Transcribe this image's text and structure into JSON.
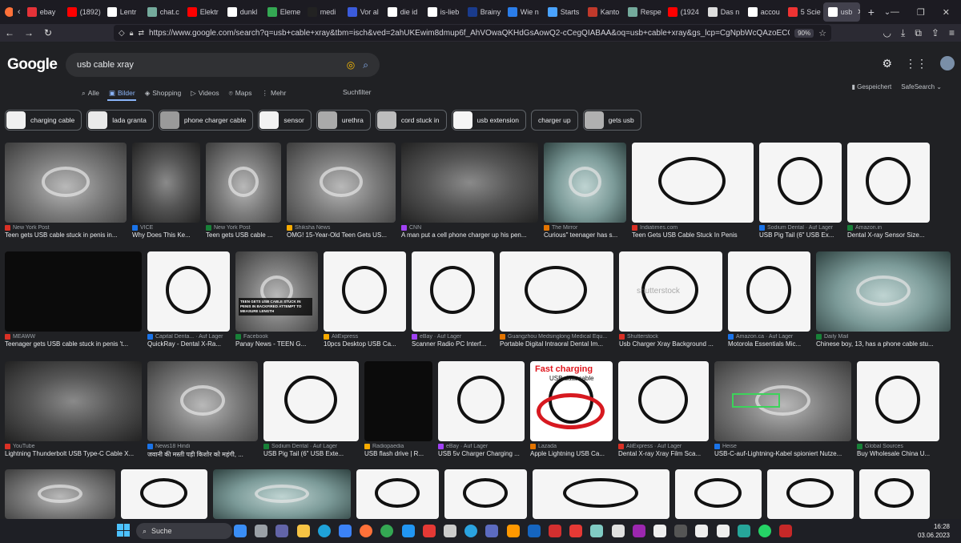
{
  "browser": {
    "tabs": [
      {
        "label": "ebay",
        "icon": "ebay-icon",
        "color": "#e53238"
      },
      {
        "label": "(1892)",
        "icon": "youtube-icon",
        "color": "#ff0000"
      },
      {
        "label": "Lentr",
        "icon": "wikipedia-icon",
        "color": "#ffffff"
      },
      {
        "label": "chat.c",
        "icon": "chatgpt-icon",
        "color": "#74aa9c"
      },
      {
        "label": "Elektr",
        "icon": "youtube-icon",
        "color": "#ff0000"
      },
      {
        "label": "dunkl",
        "icon": "google-icon",
        "color": "#ffffff"
      },
      {
        "label": "Eleme",
        "icon": "sheet-icon",
        "color": "#34a853"
      },
      {
        "label": "medi",
        "icon": "medium-icon",
        "color": "#222222"
      },
      {
        "label": "Vor al",
        "icon": "site-icon",
        "color": "#3b5bdb"
      },
      {
        "label": "die id",
        "icon": "google-icon",
        "color": "#ffffff"
      },
      {
        "label": "is-lieb",
        "icon": "google-icon",
        "color": "#ffffff"
      },
      {
        "label": "Brainy",
        "icon": "site-icon",
        "color": "#1a3b8c"
      },
      {
        "label": "Wie n",
        "icon": "site-icon",
        "color": "#2b7de9"
      },
      {
        "label": "Starts",
        "icon": "site-icon",
        "color": "#4aa3ff"
      },
      {
        "label": "Kanto",
        "icon": "site-icon",
        "color": "#c0392b"
      },
      {
        "label": "Respe",
        "icon": "chatgpt-icon",
        "color": "#74aa9c"
      },
      {
        "label": "(1924",
        "icon": "youtube-icon",
        "color": "#ff0000"
      },
      {
        "label": "Das n",
        "icon": "star-icon",
        "color": "#dddddd"
      },
      {
        "label": "accou",
        "icon": "google-icon",
        "color": "#ffffff"
      },
      {
        "label": "5 Scie",
        "icon": "site-icon",
        "color": "#e33"
      },
      {
        "label": "usb",
        "icon": "google-icon",
        "color": "#ffffff",
        "active": true
      }
    ],
    "new_tab": "+",
    "url": "https://www.google.com/search?q=usb+cable+xray&tbm=isch&ved=2ahUKEwim8dmup6f_AhVOwaQKHdGsAowQ2-cCegQIABAA&oq=usb+cable+xray&gs_lcp=CgNpbWcQAzoECCMQJzoGCAAQBxAeOgc",
    "zoom": "90%"
  },
  "google": {
    "logo": "Google",
    "query": "usb cable xray",
    "search_tabs": [
      {
        "label": "Alle",
        "icon": "search-icon"
      },
      {
        "label": "Bilder",
        "icon": "image-icon",
        "active": true
      },
      {
        "label": "Shopping",
        "icon": "tag-icon"
      },
      {
        "label": "Videos",
        "icon": "play-icon"
      },
      {
        "label": "Maps",
        "icon": "pin-icon"
      },
      {
        "label": "Mehr",
        "icon": "more-icon"
      }
    ],
    "filter": "Suchfilter",
    "saved": "Gespeichert",
    "safesearch": "SafeSearch",
    "chips": [
      {
        "label": "charging cable",
        "thumb": true
      },
      {
        "label": "lada granta",
        "thumb": true
      },
      {
        "label": "phone charger cable",
        "thumb": true
      },
      {
        "label": "sensor",
        "thumb": true
      },
      {
        "label": "urethra",
        "thumb": true
      },
      {
        "label": "cord stuck in",
        "thumb": true
      },
      {
        "label": "usb extension",
        "thumb": true
      },
      {
        "label": "charger up",
        "thumb": false
      },
      {
        "label": "gets usb",
        "thumb": true
      }
    ]
  },
  "results": {
    "row1": [
      {
        "source": "New York Post",
        "title": "Teen gets USB cable stuck in penis in...",
        "style": "xray",
        "w": 152
      },
      {
        "source": "VICE",
        "title": "Why Does This Ke...",
        "style": "xray-dark",
        "w": 85
      },
      {
        "source": "New York Post",
        "title": "Teen gets USB cable ...",
        "style": "xray",
        "w": 94
      },
      {
        "source": "Shiksha News",
        "title": "OMG! 15-Year-Old Teen Gets US...",
        "style": "xray",
        "w": 136
      },
      {
        "source": "CNN",
        "title": "A man put a cell phone charger up his pen...",
        "style": "xray-dark",
        "w": 171
      },
      {
        "source": "The Mirror",
        "title": "Curious\" teenager has s...",
        "style": "teal",
        "w": 103
      },
      {
        "source": "Indiatimes.com",
        "title": "Teen Gets USB Cable Stuck In Penis",
        "style": "white",
        "w": 152
      },
      {
        "source": "Sodium Dental · Auf Lager",
        "title": "USB Pig Tail (6\" USB Ex...",
        "style": "white",
        "w": 103
      },
      {
        "source": "Amazon.in",
        "title": "Dental X-ray Sensor Size...",
        "style": "white",
        "w": 103
      }
    ],
    "row2": [
      {
        "source": "MEAWW",
        "title": "Teenager gets USB cable stuck in penis 't...",
        "style": "black",
        "w": 171
      },
      {
        "source": "Capital Denta... · Auf Lager",
        "title": "QuickRay - Dental X-Ra...",
        "style": "white",
        "w": 103
      },
      {
        "source": "Facebook",
        "title": "Panay News - TEEN G...",
        "style": "xray",
        "w": 103
      },
      {
        "source": "AliExpress",
        "title": "10pcs Desktop USB Ca...",
        "style": "white",
        "w": 103
      },
      {
        "source": "eBay · Auf Lager",
        "title": "Scanner Radio PC Interf...",
        "style": "white",
        "w": 103
      },
      {
        "source": "Guangzhou Medsinglong Medical Equ...",
        "title": "Portable Digital Intraoral Dental Im...",
        "style": "white",
        "w": 142
      },
      {
        "source": "Shutterstock",
        "title": "Usb Charger Xray Background ...",
        "style": "white",
        "w": 129
      },
      {
        "source": "Amazon.ca · Auf Lager",
        "title": "Motorola Essentials Mic...",
        "style": "white",
        "w": 103
      },
      {
        "source": "Daily Mail",
        "title": "Chinese boy, 13, has a phone cable stu...",
        "style": "teal",
        "w": 168
      }
    ],
    "row3": [
      {
        "source": "YouTube",
        "title": "Lightning Thunderbolt USB Type-C Cable X...",
        "style": "xray-dark",
        "w": 171
      },
      {
        "source": "News18 Hindi",
        "title": "जवानी की मस्ती पड़ी किशोर को महंगी, ...",
        "style": "xray",
        "w": 138
      },
      {
        "source": "Sodium Dental · Auf Lager",
        "title": "USB Pig Tail (6\" USB Exte...",
        "style": "white",
        "w": 119
      },
      {
        "source": "Radiopaedia",
        "title": "USB flash drive | R...",
        "style": "black",
        "w": 85
      },
      {
        "source": "eBay · Auf Lager",
        "title": "USB 5v Charger Charging ...",
        "style": "white",
        "w": 108
      },
      {
        "source": "Lazada",
        "title": "Apple Lightning USB Ca...",
        "style": "white",
        "w": 103
      },
      {
        "source": "AliExpress · Auf Lager",
        "title": "Dental X-ray Xray Film Sca...",
        "style": "white",
        "w": 113
      },
      {
        "source": "Heise",
        "title": "USB-C-auf-Lightning-Kabel spioniert Nutze...",
        "style": "xray",
        "w": 171
      },
      {
        "source": "Global Sources",
        "title": "Buy Wholesale China U...",
        "style": "white",
        "w": 103
      }
    ],
    "row4": [
      {
        "style": "xray",
        "w": 138
      },
      {
        "style": "white",
        "w": 108
      },
      {
        "style": "teal",
        "w": 172
      },
      {
        "style": "white",
        "w": 103
      },
      {
        "style": "white",
        "w": 103
      },
      {
        "style": "white",
        "w": 171
      },
      {
        "style": "white",
        "w": 108
      },
      {
        "style": "white",
        "w": 108
      },
      {
        "style": "white",
        "w": 88
      }
    ],
    "overlays": {
      "fast_charging": "Fast charging",
      "usb_data_cable": "USB data cable",
      "teen_headline": "TEEN GETS USB CABLE STUCK IN PENIS IN BACKFIRED ATTEMPT TO MEASURE LENGTH",
      "shutterstock": "shutterstock"
    }
  },
  "taskbar": {
    "search_label": "Suche",
    "time": "16:28",
    "date": "03.06.2023",
    "icons": [
      {
        "name": "bing-icon",
        "color": "#3a8ef6"
      },
      {
        "name": "task-view-icon",
        "color": "#9aa0a6"
      },
      {
        "name": "teams-icon",
        "color": "#6264a7"
      },
      {
        "name": "explorer-icon",
        "color": "#f6c344"
      },
      {
        "name": "edge-icon",
        "color": "#1fa2d9"
      },
      {
        "name": "store-icon",
        "color": "#3b82f6"
      },
      {
        "name": "firefox-icon",
        "color": "#ff7139"
      },
      {
        "name": "chrome-icon",
        "color": "#34a853"
      },
      {
        "name": "app-icon",
        "color": "#2196f3"
      },
      {
        "name": "app-icon",
        "color": "#e53935"
      },
      {
        "name": "live-icon",
        "color": "#cccccc"
      },
      {
        "name": "telegram-icon",
        "color": "#2aa3e0"
      },
      {
        "name": "app-icon",
        "color": "#5c6bc0"
      },
      {
        "name": "app-icon",
        "color": "#ff9800"
      },
      {
        "name": "app-icon",
        "color": "#1565c0"
      },
      {
        "name": "app-icon",
        "color": "#d32f2f"
      },
      {
        "name": "app-icon",
        "color": "#e53935"
      },
      {
        "name": "app-icon",
        "color": "#80cbc4"
      },
      {
        "name": "app-icon",
        "color": "#e0e0e0"
      },
      {
        "name": "app-icon",
        "color": "#9c27b0"
      },
      {
        "name": "app-icon",
        "color": "#eeeeee"
      },
      {
        "name": "terminal-icon",
        "color": "#555555"
      },
      {
        "name": "linux-icon",
        "color": "#eeeeee"
      },
      {
        "name": "linux-icon",
        "color": "#eeeeee"
      },
      {
        "name": "app-icon",
        "color": "#26a69a"
      },
      {
        "name": "whatsapp-icon",
        "color": "#25d366"
      },
      {
        "name": "app-icon",
        "color": "#c62828"
      }
    ]
  }
}
